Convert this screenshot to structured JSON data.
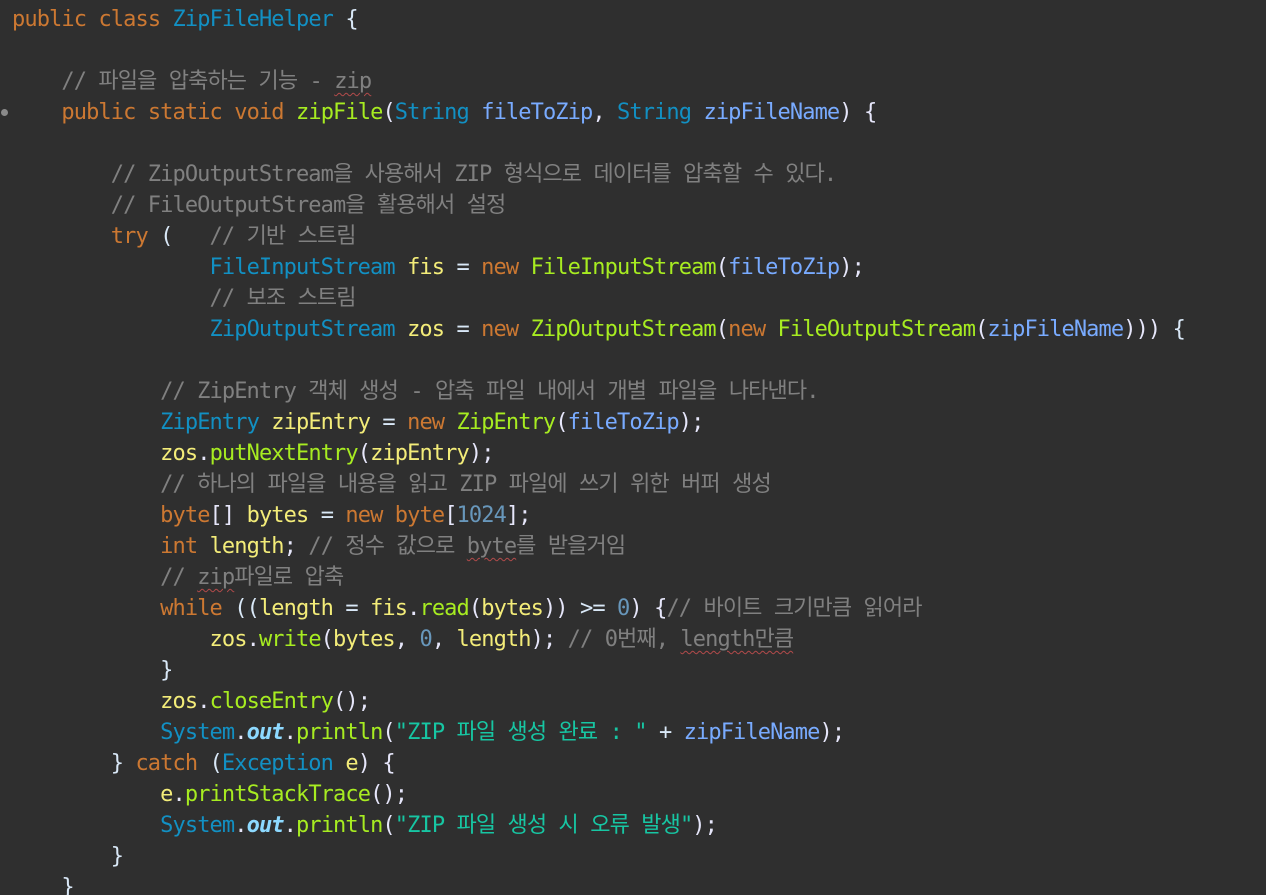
{
  "theme": {
    "background": "#2f2f2f",
    "keyword": "#cc7832",
    "type": "#1290c3",
    "method": "#a7ec21",
    "param": "#79abff",
    "local": "#f3ec79",
    "comment": "#808080",
    "string": "#17c6a3",
    "number": "#6897bb",
    "plain": "#d9e8f7"
  },
  "code": {
    "lines": [
      [
        [
          "keyword",
          "public"
        ],
        [
          "plain",
          " "
        ],
        [
          "keyword",
          "class"
        ],
        [
          "plain",
          " "
        ],
        [
          "type",
          "ZipFileHelper"
        ],
        [
          "plain",
          " {"
        ]
      ],
      [],
      [
        [
          "comment",
          "    // 파일을 압축하는 기능 - "
        ],
        [
          "comment-spell",
          "zip"
        ]
      ],
      [
        [
          "plain",
          "    "
        ],
        [
          "keyword",
          "public"
        ],
        [
          "plain",
          " "
        ],
        [
          "keyword",
          "static"
        ],
        [
          "plain",
          " "
        ],
        [
          "keyword",
          "void"
        ],
        [
          "plain",
          " "
        ],
        [
          "method",
          "zipFile"
        ],
        [
          "punct",
          "("
        ],
        [
          "type",
          "String"
        ],
        [
          "plain",
          " "
        ],
        [
          "param",
          "fileToZip"
        ],
        [
          "punct",
          ", "
        ],
        [
          "type",
          "String"
        ],
        [
          "plain",
          " "
        ],
        [
          "param",
          "zipFileName"
        ],
        [
          "punct",
          ") {"
        ]
      ],
      [],
      [
        [
          "comment",
          "        // ZipOutputStream을 사용해서 ZIP 형식으로 데이터를 압축할 수 있다."
        ]
      ],
      [
        [
          "comment",
          "        // FileOutputStream을 활용해서 설정"
        ]
      ],
      [
        [
          "plain",
          "        "
        ],
        [
          "keyword",
          "try"
        ],
        [
          "plain",
          " (   "
        ],
        [
          "comment",
          "// 기반 스트림"
        ]
      ],
      [
        [
          "plain",
          "                "
        ],
        [
          "type",
          "FileInputStream"
        ],
        [
          "plain",
          " "
        ],
        [
          "local",
          "fis"
        ],
        [
          "plain",
          " = "
        ],
        [
          "keyword",
          "new"
        ],
        [
          "plain",
          " "
        ],
        [
          "method",
          "FileInputStream"
        ],
        [
          "punct",
          "("
        ],
        [
          "param",
          "fileToZip"
        ],
        [
          "punct",
          ");"
        ]
      ],
      [
        [
          "plain",
          "                "
        ],
        [
          "comment",
          "// 보조 스트림"
        ]
      ],
      [
        [
          "plain",
          "                "
        ],
        [
          "type",
          "ZipOutputStream"
        ],
        [
          "plain",
          " "
        ],
        [
          "local",
          "zos"
        ],
        [
          "plain",
          " = "
        ],
        [
          "keyword",
          "new"
        ],
        [
          "plain",
          " "
        ],
        [
          "method",
          "ZipOutputStream"
        ],
        [
          "punct",
          "("
        ],
        [
          "keyword",
          "new"
        ],
        [
          "plain",
          " "
        ],
        [
          "method",
          "FileOutputStream"
        ],
        [
          "punct",
          "("
        ],
        [
          "param",
          "zipFileName"
        ],
        [
          "punct",
          ")))"
        ],
        [
          "plain",
          " {"
        ]
      ],
      [],
      [
        [
          "comment",
          "            // ZipEntry 객체 생성 - 압축 파일 내에서 개별 파일을 나타낸다."
        ]
      ],
      [
        [
          "plain",
          "            "
        ],
        [
          "type",
          "ZipEntry"
        ],
        [
          "plain",
          " "
        ],
        [
          "local",
          "zipEntry"
        ],
        [
          "plain",
          " = "
        ],
        [
          "keyword",
          "new"
        ],
        [
          "plain",
          " "
        ],
        [
          "method",
          "ZipEntry"
        ],
        [
          "punct",
          "("
        ],
        [
          "param",
          "fileToZip"
        ],
        [
          "punct",
          ");"
        ]
      ],
      [
        [
          "plain",
          "            "
        ],
        [
          "local",
          "zos"
        ],
        [
          "punct",
          "."
        ],
        [
          "method",
          "putNextEntry"
        ],
        [
          "punct",
          "("
        ],
        [
          "local",
          "zipEntry"
        ],
        [
          "punct",
          ");"
        ]
      ],
      [
        [
          "comment",
          "            // 하나의 파일을 내용을 읽고 ZIP 파일에 쓰기 위한 버퍼 생성"
        ]
      ],
      [
        [
          "plain",
          "            "
        ],
        [
          "keyword",
          "byte"
        ],
        [
          "punct",
          "[]"
        ],
        [
          "plain",
          " "
        ],
        [
          "local",
          "bytes"
        ],
        [
          "plain",
          " = "
        ],
        [
          "keyword",
          "new"
        ],
        [
          "plain",
          " "
        ],
        [
          "keyword",
          "byte"
        ],
        [
          "punct",
          "["
        ],
        [
          "number",
          "1024"
        ],
        [
          "punct",
          "];"
        ]
      ],
      [
        [
          "plain",
          "            "
        ],
        [
          "keyword",
          "int"
        ],
        [
          "plain",
          " "
        ],
        [
          "local",
          "length"
        ],
        [
          "punct",
          ";"
        ],
        [
          "comment",
          " // 정수 값으로 "
        ],
        [
          "comment-spell",
          "byte"
        ],
        [
          "comment",
          "를 받을거임"
        ]
      ],
      [
        [
          "comment",
          "            // "
        ],
        [
          "comment-spell",
          "zip"
        ],
        [
          "comment",
          "파일로 압축"
        ]
      ],
      [
        [
          "plain",
          "            "
        ],
        [
          "keyword",
          "while"
        ],
        [
          "plain",
          " (("
        ],
        [
          "local",
          "length"
        ],
        [
          "plain",
          " = "
        ],
        [
          "local",
          "fis"
        ],
        [
          "punct",
          "."
        ],
        [
          "method",
          "read"
        ],
        [
          "punct",
          "("
        ],
        [
          "local",
          "bytes"
        ],
        [
          "punct",
          "))"
        ],
        [
          "plain",
          " >= "
        ],
        [
          "number",
          "0"
        ],
        [
          "punct",
          ") {"
        ],
        [
          "comment",
          "// 바이트 크기만큼 읽어라"
        ]
      ],
      [
        [
          "plain",
          "                "
        ],
        [
          "local",
          "zos"
        ],
        [
          "punct",
          "."
        ],
        [
          "method",
          "write"
        ],
        [
          "punct",
          "("
        ],
        [
          "local",
          "bytes"
        ],
        [
          "punct",
          ", "
        ],
        [
          "number",
          "0"
        ],
        [
          "punct",
          ", "
        ],
        [
          "local",
          "length"
        ],
        [
          "punct",
          ");"
        ],
        [
          "comment",
          " // 0번째, "
        ],
        [
          "comment-spell",
          "length만큼"
        ]
      ],
      [
        [
          "plain",
          "            }"
        ]
      ],
      [
        [
          "plain",
          "            "
        ],
        [
          "local",
          "zos"
        ],
        [
          "punct",
          "."
        ],
        [
          "method",
          "closeEntry"
        ],
        [
          "punct",
          "();"
        ]
      ],
      [
        [
          "plain",
          "            "
        ],
        [
          "type",
          "System"
        ],
        [
          "punct",
          "."
        ],
        [
          "field",
          "out"
        ],
        [
          "punct",
          "."
        ],
        [
          "method",
          "println"
        ],
        [
          "punct",
          "("
        ],
        [
          "string",
          "\"ZIP 파일 생성 완료 : \""
        ],
        [
          "plain",
          " + "
        ],
        [
          "param",
          "zipFileName"
        ],
        [
          "punct",
          ");"
        ]
      ],
      [
        [
          "plain",
          "        } "
        ],
        [
          "keyword",
          "catch"
        ],
        [
          "plain",
          " ("
        ],
        [
          "type",
          "Exception"
        ],
        [
          "plain",
          " "
        ],
        [
          "local",
          "e"
        ],
        [
          "punct",
          ") {"
        ]
      ],
      [
        [
          "plain",
          "            "
        ],
        [
          "local",
          "e"
        ],
        [
          "punct",
          "."
        ],
        [
          "method",
          "printStackTrace"
        ],
        [
          "punct",
          "();"
        ]
      ],
      [
        [
          "plain",
          "            "
        ],
        [
          "type",
          "System"
        ],
        [
          "punct",
          "."
        ],
        [
          "field",
          "out"
        ],
        [
          "punct",
          "."
        ],
        [
          "method",
          "println"
        ],
        [
          "punct",
          "("
        ],
        [
          "string",
          "\"ZIP 파일 생성 시 오류 발생\""
        ],
        [
          "punct",
          ");"
        ]
      ],
      [
        [
          "plain",
          "        }"
        ]
      ],
      [
        [
          "plain",
          "    }"
        ]
      ]
    ],
    "markers": [
      3
    ]
  }
}
